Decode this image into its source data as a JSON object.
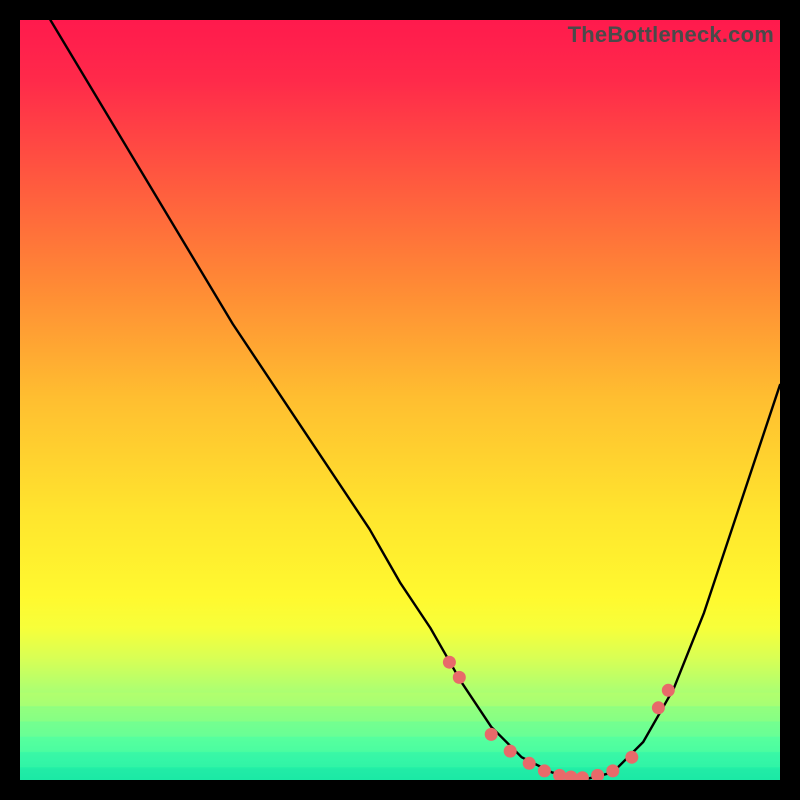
{
  "watermark": "TheBottleneck.com",
  "colors": {
    "frame": "#000000",
    "watermark": "#4a4a4a",
    "curve": "#000000",
    "marker": "#e86a6a",
    "gradient_stops": [
      {
        "offset": 0.0,
        "color": "#ff1a4d"
      },
      {
        "offset": 0.08,
        "color": "#ff2a4a"
      },
      {
        "offset": 0.2,
        "color": "#ff5540"
      },
      {
        "offset": 0.35,
        "color": "#ff8a35"
      },
      {
        "offset": 0.5,
        "color": "#ffbf30"
      },
      {
        "offset": 0.65,
        "color": "#ffe52e"
      },
      {
        "offset": 0.76,
        "color": "#fff92f"
      },
      {
        "offset": 0.8,
        "color": "#f7ff3a"
      },
      {
        "offset": 0.84,
        "color": "#d8ff55"
      },
      {
        "offset": 0.885,
        "color": "#aaff73"
      },
      {
        "offset": 0.915,
        "color": "#7fff8a"
      },
      {
        "offset": 0.945,
        "color": "#55ffa0"
      },
      {
        "offset": 0.972,
        "color": "#30f6a8"
      },
      {
        "offset": 1.0,
        "color": "#15e8a5"
      }
    ],
    "bands": [
      {
        "y": 0.885,
        "color": "#b8ff69"
      },
      {
        "y": 0.905,
        "color": "#96ff7c"
      },
      {
        "y": 0.925,
        "color": "#77ff8e"
      },
      {
        "y": 0.945,
        "color": "#58ff9d"
      },
      {
        "y": 0.965,
        "color": "#3af6a6"
      },
      {
        "y": 0.985,
        "color": "#20eaa6"
      }
    ]
  },
  "chart_data": {
    "type": "line",
    "title": "",
    "xlabel": "",
    "ylabel": "",
    "xlim": [
      0,
      100
    ],
    "ylim": [
      0,
      100
    ],
    "series": [
      {
        "name": "bottleneck-curve",
        "x": [
          4,
          10,
          16,
          22,
          28,
          34,
          40,
          46,
          50,
          54,
          58,
          62,
          66,
          70,
          74,
          78,
          82,
          86,
          90,
          94,
          98,
          100
        ],
        "y": [
          100,
          90,
          80,
          70,
          60,
          51,
          42,
          33,
          26,
          20,
          13,
          7,
          3,
          1,
          0,
          1,
          5,
          12,
          22,
          34,
          46,
          52
        ]
      }
    ],
    "markers": {
      "name": "highlight-points",
      "x": [
        56.5,
        57.8,
        62.0,
        64.5,
        67.0,
        69.0,
        71.0,
        72.5,
        74.0,
        76.0,
        78.0,
        80.5,
        84.0,
        85.3
      ],
      "y": [
        15.5,
        13.5,
        6.0,
        3.8,
        2.2,
        1.2,
        0.6,
        0.4,
        0.3,
        0.6,
        1.2,
        3.0,
        9.5,
        11.8
      ]
    }
  }
}
